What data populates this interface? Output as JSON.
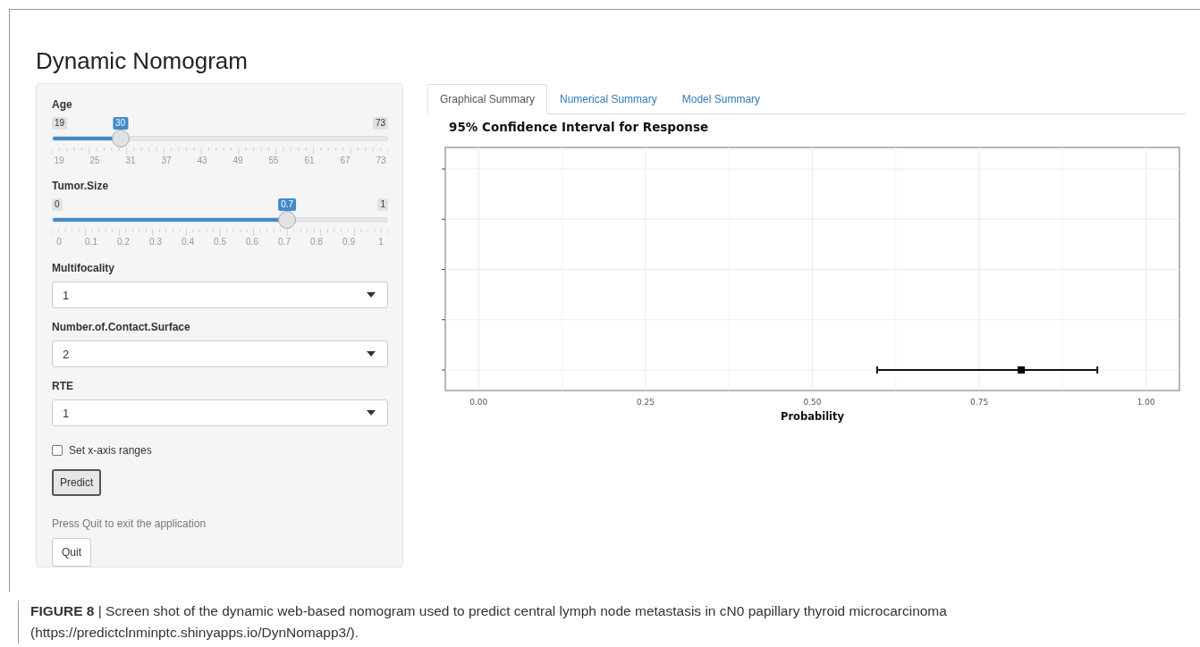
{
  "page": {
    "title": "Dynamic Nomogram"
  },
  "sidebar": {
    "sliders": [
      {
        "label": "Age",
        "min": "19",
        "max": "73",
        "value": "30",
        "level": 0.2037,
        "ticks": [
          "19",
          "25",
          "31",
          "37",
          "43",
          "49",
          "55",
          "61",
          "67",
          "73"
        ]
      },
      {
        "label": "Tumor.Size",
        "min": "0",
        "max": "1",
        "value": "0.7",
        "level": 0.7,
        "ticks": [
          "0",
          "0.1",
          "0.2",
          "0.3",
          "0.4",
          "0.5",
          "0.6",
          "0.7",
          "0.8",
          "0.9",
          "1"
        ]
      }
    ],
    "selects": [
      {
        "label": "Multifocality",
        "value": "1"
      },
      {
        "label": "Number.of.Contact.Surface",
        "value": "2"
      },
      {
        "label": "RTE",
        "value": "1"
      }
    ],
    "checkbox": {
      "label": "Set x-axis ranges",
      "checked": false
    },
    "predict_button": "Predict",
    "quit_note": "Press Quit to exit the application",
    "quit_button": "Quit"
  },
  "tabs": [
    {
      "label": "Graphical Summary",
      "selected": true
    },
    {
      "label": "Numerical Summary",
      "selected": false
    },
    {
      "label": "Model Summary",
      "selected": false
    }
  ],
  "plot": {
    "title": "95% Confidence Interval for Response",
    "chart_data": {
      "type": "scatter",
      "xlabel": "Probability",
      "xlim": [
        -0.05,
        1.05
      ],
      "xticks": [
        {
          "value": 0,
          "label": "0.00"
        },
        {
          "value": 0.25,
          "label": "0.25"
        },
        {
          "value": 0.5,
          "label": "0.50"
        },
        {
          "value": 0.75,
          "label": "0.75"
        },
        {
          "value": 1,
          "label": "1.00"
        }
      ],
      "orientation": "horizontal",
      "categories": [
        null,
        null,
        null,
        null,
        null
      ],
      "grid": true,
      "series": [
        {
          "values": [
            null,
            null,
            null,
            null,
            0.813
          ],
          "errors": [
            null,
            null,
            null,
            null,
            [
              0.597,
              0.927
            ]
          ]
        }
      ]
    }
  },
  "caption": "**FIGURE 8** | Screen shot of the dynamic web-based nomogram used to predict central lymph node metastasis in cN0 papillary thyroid microcarcinoma (https://predictclnminptc.shinyapps.io/DynNomapp3/)."
}
